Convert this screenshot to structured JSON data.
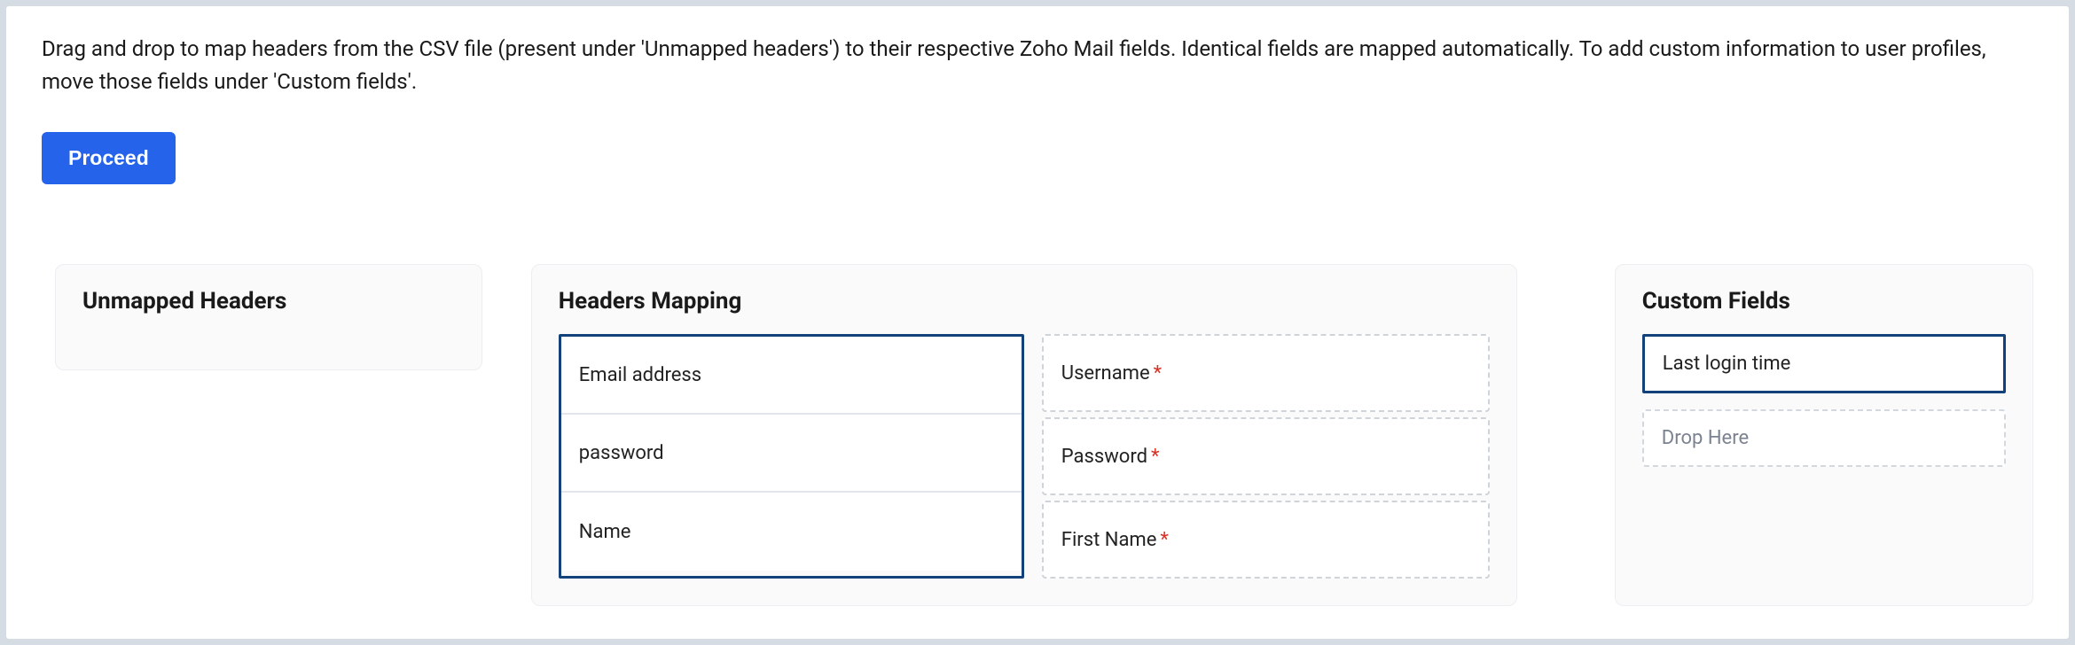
{
  "instructions": "Drag and drop to map headers from the CSV file (present under 'Unmapped headers') to their respective Zoho Mail fields. Identical fields are mapped automatically. To add custom information to user profiles, move those fields under 'Custom fields'.",
  "proceed_label": "Proceed",
  "panels": {
    "unmapped_title": "Unmapped Headers",
    "mapping_title": "Headers Mapping",
    "custom_title": "Custom Fields"
  },
  "mapping": {
    "sources": [
      "Email address",
      "password",
      "Name"
    ],
    "targets": [
      {
        "label": "Username",
        "required": true
      },
      {
        "label": "Password",
        "required": true
      },
      {
        "label": "First Name",
        "required": true
      }
    ]
  },
  "custom": {
    "items": [
      "Last login time"
    ],
    "drop_placeholder": "Drop Here"
  }
}
